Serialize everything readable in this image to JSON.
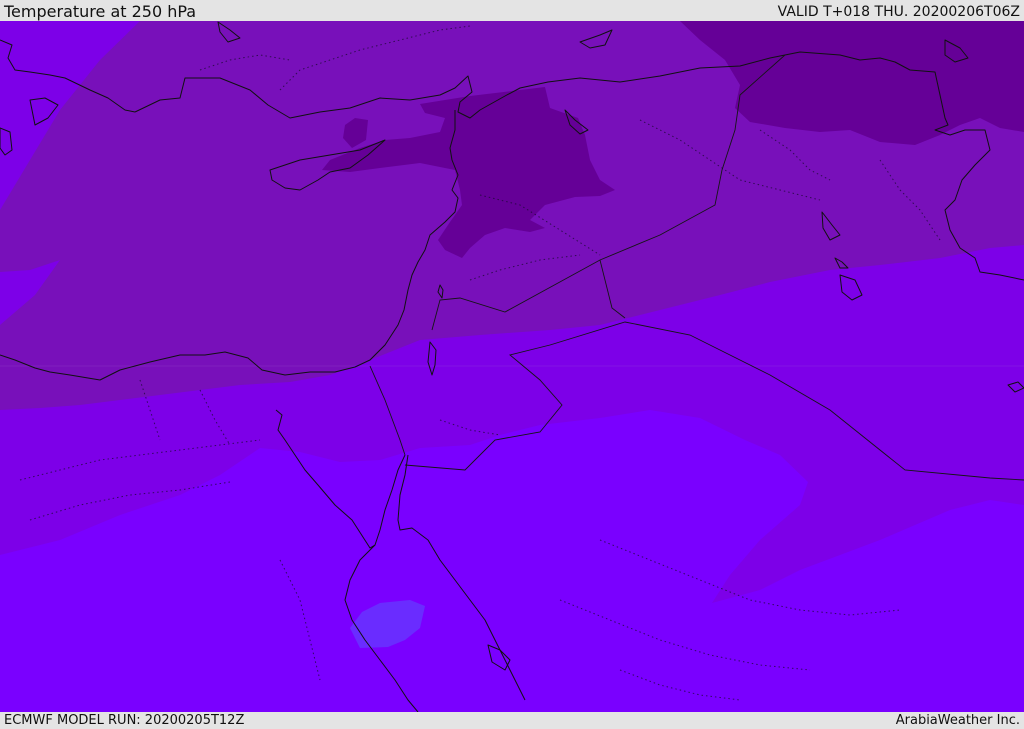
{
  "header": {
    "title": "Temperature at 250 hPa",
    "valid": "VALID T+018 THU. 20200206T06Z"
  },
  "footer": {
    "model_run": "ECMWF MODEL RUN: 20200205T12Z",
    "credit": "ArabiaWeather Inc."
  },
  "map": {
    "colors": {
      "level_warmest": "#7a00ff",
      "level_mid": "#7d00e8",
      "level_cool": "#7810ba",
      "level_coldest": "#650097",
      "patch_light": "#6a2cff",
      "coastline": "#111111"
    }
  }
}
